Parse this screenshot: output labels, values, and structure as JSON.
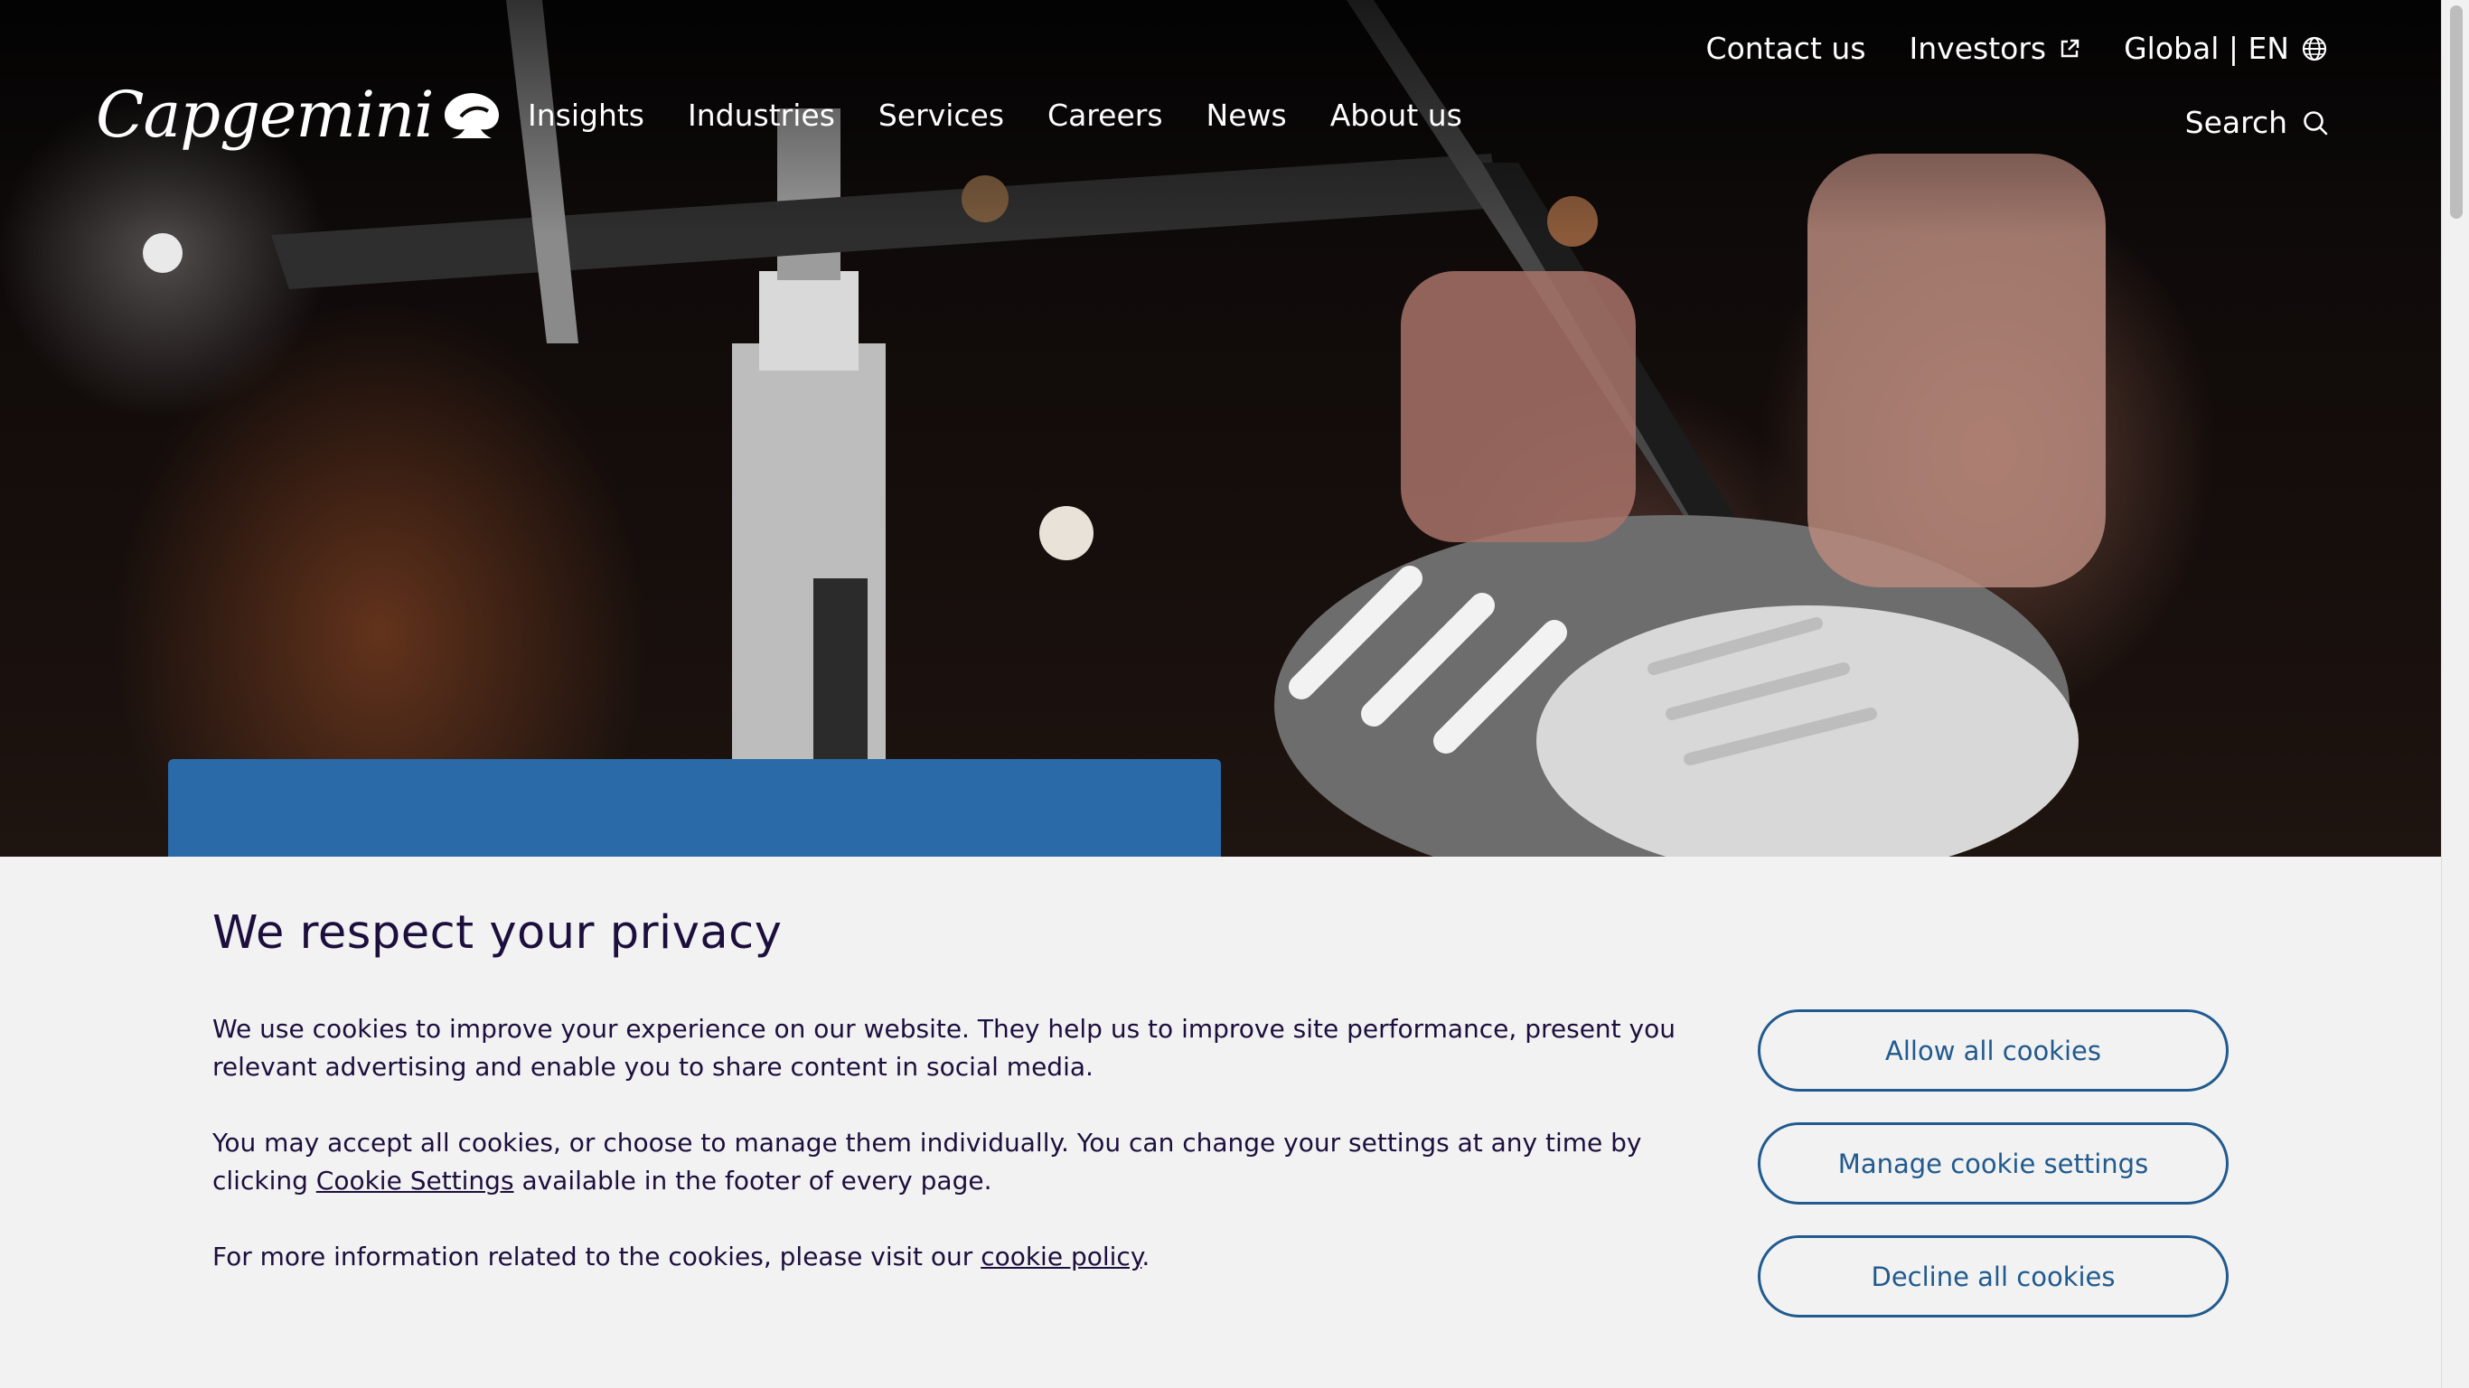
{
  "header": {
    "logo_text": "Capgemini",
    "main_nav": [
      "Insights",
      "Industries",
      "Services",
      "Careers",
      "News",
      "About us"
    ],
    "utility": {
      "contact": "Contact us",
      "investors": "Investors",
      "locale": "Global | EN"
    },
    "search_label": "Search"
  },
  "privacy": {
    "title": "We respect your privacy",
    "p1": "We use cookies to improve your experience on our website. They help us to improve site performance, present you relevant advertising and enable you to share content in social media.",
    "p2_before": "You may accept all cookies, or choose to manage them individually. You can change your settings at any time by clicking ",
    "p2_link": "Cookie Settings",
    "p2_after": " available in the footer of every page.",
    "p3_before": "For more information related to the cookies, please visit our ",
    "p3_link": "cookie policy",
    "p3_after": "."
  },
  "buttons": {
    "allow": "Allow all cookies",
    "manage": "Manage cookie settings",
    "decline": "Decline all cookies"
  },
  "colors": {
    "accent": "#215a8e",
    "hero_card": "#2b6aa8",
    "text": "#1d0f3d",
    "banner_bg": "#f2f2f2"
  }
}
